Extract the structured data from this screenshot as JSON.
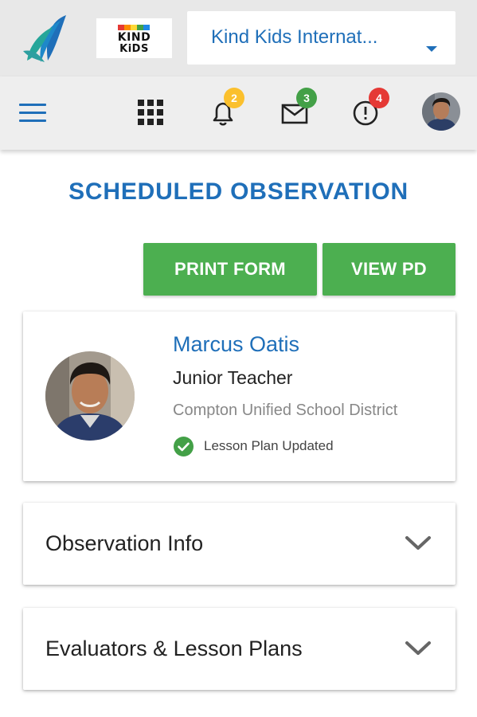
{
  "header": {
    "app_logo_icon": "sail-logo-icon",
    "org_logo": {
      "line1": "KIND",
      "line2": "KiDS",
      "bar_colors": [
        "#e53935",
        "#fb8c00",
        "#fdd835",
        "#43a047",
        "#1e88e5"
      ]
    },
    "org_selector": {
      "value": "Kind Kids Internat...",
      "caret_icon": "caret-down-icon"
    }
  },
  "nav": {
    "menu_icon": "hamburger-menu-icon",
    "apps_icon": "apps-grid-icon",
    "notifications": {
      "icon": "bell-icon",
      "count": "2",
      "badge_color": "#fbc02d"
    },
    "messages": {
      "icon": "mail-icon",
      "count": "3",
      "badge_color": "#43a047"
    },
    "alerts": {
      "icon": "alert-circle-icon",
      "count": "4",
      "badge_color": "#e53935"
    },
    "avatar": "user-avatar"
  },
  "page": {
    "title": "SCHEDULED OBSERVATION",
    "buttons": {
      "print": "PRINT FORM",
      "view_pd": "VIEW PD"
    }
  },
  "profile": {
    "name": "Marcus Oatis",
    "role": "Junior Teacher",
    "district": "Compton Unified School District",
    "status": "Lesson Plan Updated",
    "status_icon": "check-circle-icon"
  },
  "sections": [
    {
      "label": "Observation Info",
      "icon": "chevron-down-icon"
    },
    {
      "label": "Evaluators & Lesson Plans",
      "icon": "chevron-down-icon"
    }
  ],
  "colors": {
    "primary": "#1f6fb9",
    "button_green": "#4caf50",
    "status_green": "#43a047",
    "top_bar_bg": "#e8e8e8",
    "nav_bar_bg": "#eeeeee"
  }
}
